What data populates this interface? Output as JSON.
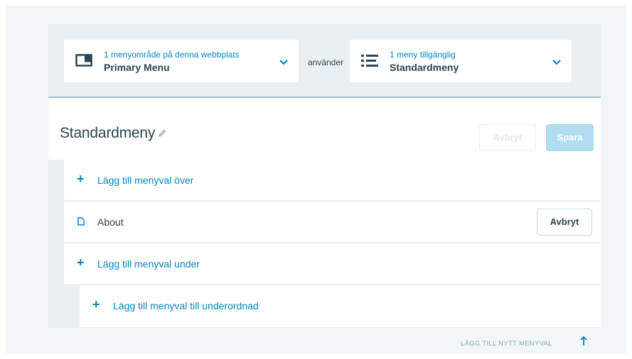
{
  "location_selector": {
    "subtitle": "1 menyområde på denna webbplats",
    "title": "Primary Menu",
    "icon": "layout-icon"
  },
  "uses_label": "använder",
  "menu_selector": {
    "subtitle": "1 meny tillgänglig",
    "title": "Standardmeny",
    "icon": "list-icon"
  },
  "menu": {
    "name": "Standardmeny",
    "cancel_label": "Avbryt",
    "save_label": "Spara"
  },
  "rows": {
    "add_above": "Lägg till menyval över",
    "item_about": "About",
    "item_cancel": "Avbryt",
    "add_below": "Lägg till menyval under",
    "add_child": "Lägg till menyval till underordnad"
  },
  "add_new_item": "LÄGG TILL NYTT MENYVAL",
  "colors": {
    "accent": "#0087be",
    "text": "#2e4453",
    "save_disabled": "#b2dcef"
  }
}
